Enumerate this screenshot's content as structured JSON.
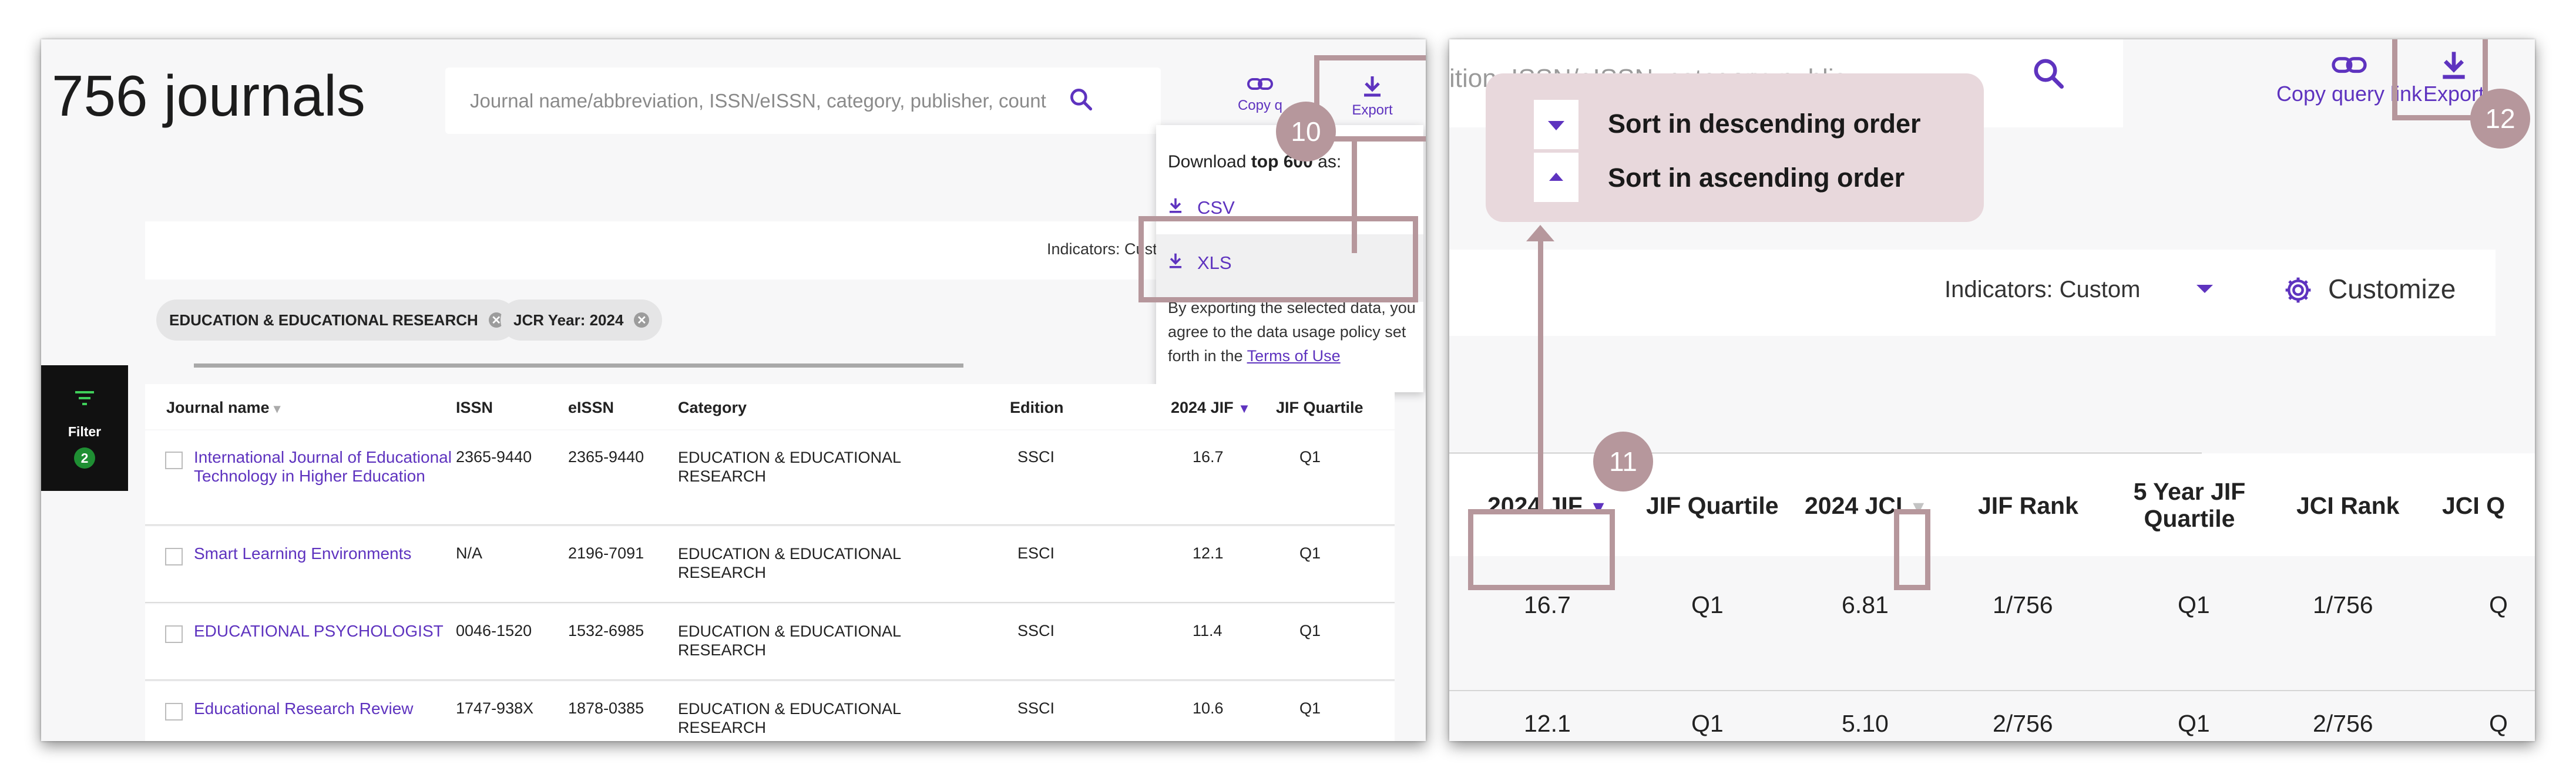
{
  "left": {
    "result_count": "756 journals",
    "search_placeholder": "Journal name/abbreviation, ISSN/eISSN, category, publisher, count",
    "copy_label": "Copy q",
    "export_label": "Export",
    "export_menu": {
      "prefix": "Download ",
      "bold": "top 600",
      "suffix": " as:",
      "csv": "CSV",
      "xls": "XLS",
      "note_text": "By exporting the selected data, you agree to the data usage policy set forth in the ",
      "note_link": "Terms of Use"
    },
    "indicators_label": "Indicators: Custom",
    "chips": [
      "EDUCATION & EDUCATIONAL RESEARCH",
      "JCR Year: 2024"
    ],
    "filter_label": "Filter",
    "filter_count": "2",
    "columns": [
      "Journal name",
      "ISSN",
      "eISSN",
      "Category",
      "Edition",
      "2024 JIF",
      "JIF Quartile"
    ],
    "rows": [
      {
        "name": "International Journal of Educational Technology in Higher Education",
        "issn": "2365-9440",
        "eissn": "2365-9440",
        "category": "EDUCATION & EDUCATIONAL RESEARCH",
        "edition": "SSCI",
        "jif": "16.7",
        "quartile": "Q1"
      },
      {
        "name": "Smart Learning Environments",
        "issn": "N/A",
        "eissn": "2196-7091",
        "category": "EDUCATION & EDUCATIONAL RESEARCH",
        "edition": "ESCI",
        "jif": "12.1",
        "quartile": "Q1"
      },
      {
        "name": "EDUCATIONAL PSYCHOLOGIST",
        "issn": "0046-1520",
        "eissn": "1532-6985",
        "category": "EDUCATION & EDUCATIONAL RESEARCH",
        "edition": "SSCI",
        "jif": "11.4",
        "quartile": "Q1"
      },
      {
        "name": "Educational Research Review",
        "issn": "1747-938X",
        "eissn": "1878-0385",
        "category": "EDUCATION & EDUCATIONAL RESEARCH",
        "edition": "SSCI",
        "jif": "10.6",
        "quartile": "Q1"
      }
    ],
    "callout_10": "10"
  },
  "right": {
    "search_fragment": "ition, ISSN/eISSN, category, publis",
    "copy_label": "Copy query link",
    "export_label": "Export",
    "tooltip": {
      "descending": "Sort in descending order",
      "ascending": "Sort in ascending order"
    },
    "indicators_label": "Indicators: Custom",
    "customize_label": "Customize",
    "columns": [
      "2024 JIF",
      "JIF Quartile",
      "2024 JCI",
      "JIF Rank",
      "5 Year JIF Quartile",
      "JCI Rank",
      "JCI Q"
    ],
    "rows": [
      [
        "16.7",
        "Q1",
        "6.81",
        "1/756",
        "Q1",
        "1/756",
        "Q"
      ],
      [
        "12.1",
        "Q1",
        "5.10",
        "2/756",
        "Q1",
        "2/756",
        "Q"
      ]
    ],
    "callout_11": "11",
    "callout_12": "12"
  },
  "colors": {
    "accent": "#5e33bf",
    "callout": "#b6979c",
    "tooltip_bg": "#e8d8dc"
  }
}
